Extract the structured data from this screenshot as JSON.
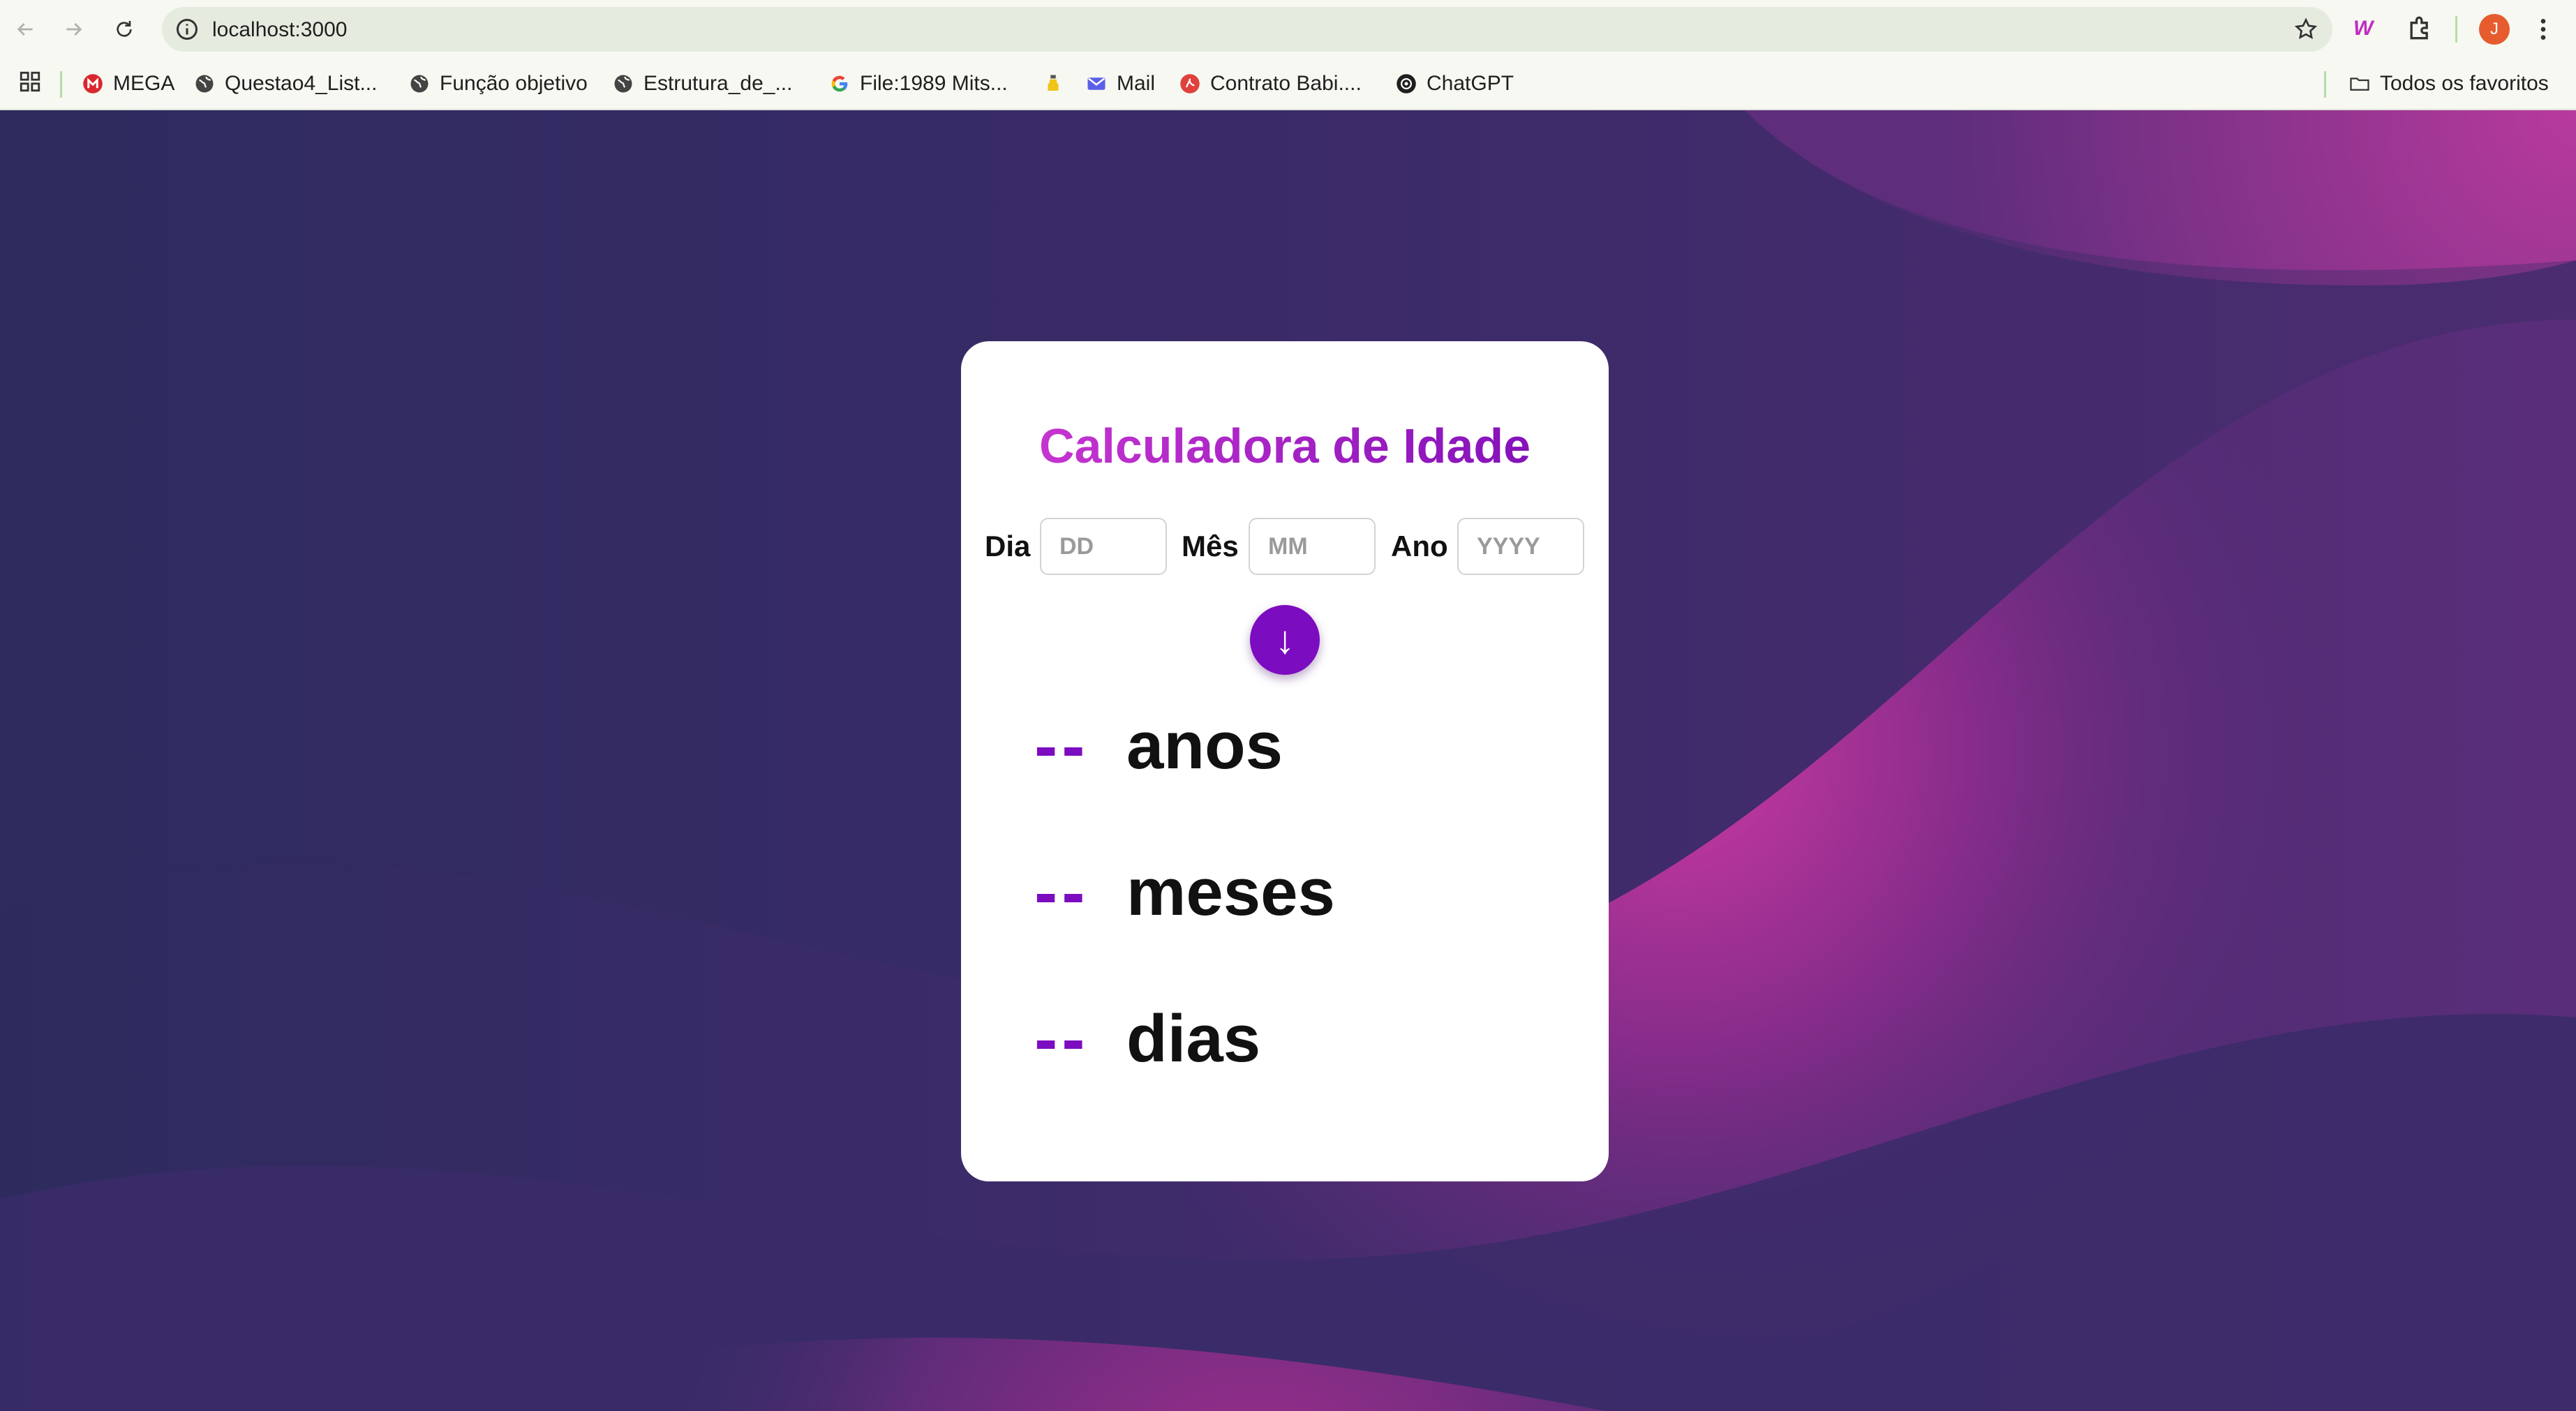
{
  "browser": {
    "url": "localhost:3000",
    "avatar_initial": "J",
    "bookmarks": [
      {
        "label": "MEGA",
        "icon": "mega-icon"
      },
      {
        "label": "Questao4_List...",
        "icon": "globe-icon"
      },
      {
        "label": "Função objetivo",
        "icon": "globe-icon"
      },
      {
        "label": "Estrutura_de_...",
        "icon": "globe-icon"
      },
      {
        "label": "File:1989 Mits...",
        "icon": "google-icon"
      },
      {
        "label": "",
        "icon": "potion-icon"
      },
      {
        "label": "Mail",
        "icon": "mail-icon"
      },
      {
        "label": "Contrato Babi....",
        "icon": "pdf-icon"
      },
      {
        "label": "ChatGPT",
        "icon": "chatgpt-icon"
      }
    ],
    "all_bookmarks_label": "Todos os favoritos"
  },
  "app": {
    "title": "Calculadora de Idade",
    "inputs": {
      "day_label": "Dia",
      "day_placeholder": "DD",
      "day_value": "",
      "month_label": "Mês",
      "month_placeholder": "MM",
      "month_value": "",
      "year_label": "Ano",
      "year_placeholder": "YYYY",
      "year_value": ""
    },
    "submit_symbol": "↓",
    "results": [
      {
        "value": "--",
        "unit": "anos"
      },
      {
        "value": "--",
        "unit": "meses"
      },
      {
        "value": "--",
        "unit": "dias"
      }
    ]
  },
  "colors": {
    "accent": "#7c0cbf",
    "title_gradient_start": "#d03ad3",
    "title_gradient_end": "#7a0cb6",
    "background_dark": "#2f2b5c",
    "background_magenta": "#c52a9a"
  }
}
